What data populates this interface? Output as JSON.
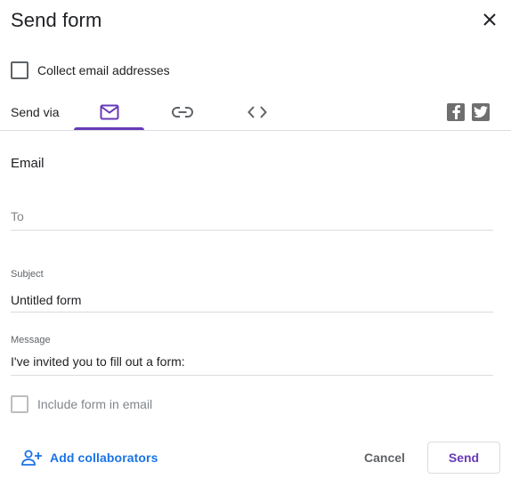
{
  "dialog": {
    "title": "Send form",
    "close_icon": "close-icon"
  },
  "collect_email": {
    "label": "Collect email addresses",
    "checked": false
  },
  "send_via": {
    "label": "Send via",
    "tabs": [
      {
        "id": "email",
        "icon": "mail-icon",
        "selected": true
      },
      {
        "id": "link",
        "icon": "link-icon",
        "selected": false
      },
      {
        "id": "embed",
        "icon": "code-icon",
        "selected": false
      }
    ],
    "social": [
      {
        "id": "facebook",
        "icon": "facebook-icon"
      },
      {
        "id": "twitter",
        "icon": "twitter-icon"
      }
    ]
  },
  "email_section": {
    "title": "Email",
    "to": {
      "placeholder": "To",
      "value": ""
    },
    "subject": {
      "label": "Subject",
      "value": "Untitled form"
    },
    "message": {
      "label": "Message",
      "value": "I've invited you to fill out a form:"
    },
    "include_form": {
      "label": "Include form in email",
      "checked": false
    }
  },
  "footer": {
    "add_collaborators": "Add collaborators",
    "cancel": "Cancel",
    "send": "Send"
  },
  "colors": {
    "accent": "#673ab7",
    "link": "#1a73e8",
    "divider": "#dadce0",
    "social_icon_bg": "#6f6f6f"
  }
}
